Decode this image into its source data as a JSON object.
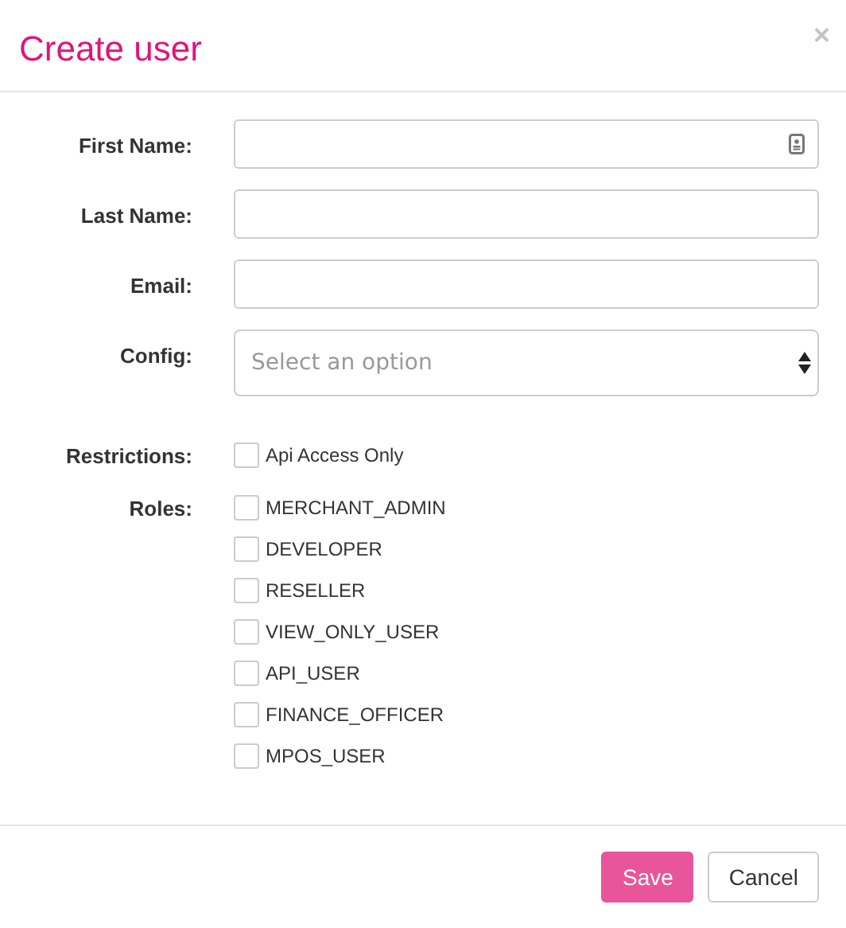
{
  "title": "Create user",
  "close": "×",
  "fields": [
    {
      "kind": "contact",
      "label": "First Name:"
    },
    {
      "kind": "text",
      "label": "Last Name:"
    },
    {
      "kind": "text",
      "label": "Email:"
    },
    {
      "kind": "select",
      "label": "Config:",
      "placeholder": "Select an option"
    }
  ],
  "checkgroups": [
    {
      "label": "Restrictions:",
      "options": [
        {
          "label": "Api Access Only",
          "checked": false
        }
      ]
    },
    {
      "label": "Roles:",
      "options": [
        {
          "label": "MERCHANT_ADMIN",
          "checked": false
        },
        {
          "label": "DEVELOPER",
          "checked": false
        },
        {
          "label": "RESELLER",
          "checked": false
        },
        {
          "label": "VIEW_ONLY_USER",
          "checked": false
        },
        {
          "label": "API_USER",
          "checked": false
        },
        {
          "label": "FINANCE_OFFICER",
          "checked": false
        },
        {
          "label": "MPOS_USER",
          "checked": false
        }
      ]
    }
  ],
  "buttons": [
    {
      "label": "Save",
      "kind": "primary"
    },
    {
      "label": "Cancel",
      "kind": "default"
    }
  ]
}
